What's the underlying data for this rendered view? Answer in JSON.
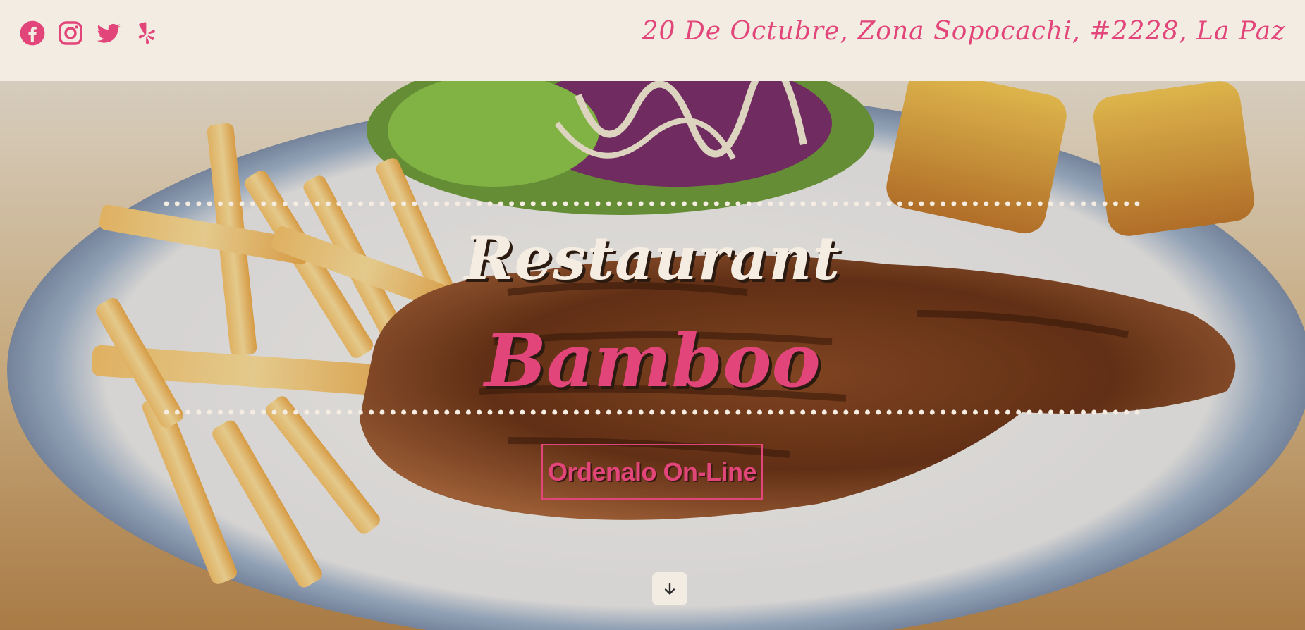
{
  "header": {
    "socials": [
      {
        "icon": "facebook-icon"
      },
      {
        "icon": "instagram-icon"
      },
      {
        "icon": "twitter-icon"
      },
      {
        "icon": "yelp-icon"
      }
    ],
    "address": "20 De Octubre, Zona Sopocachi, #2228, La Paz"
  },
  "hero": {
    "title_line1": "Restaurant",
    "title_line2": "Bamboo",
    "order_button": "Ordenalo On-Line",
    "scroll_icon": "arrow-down-icon"
  },
  "colors": {
    "accent": "#e2457a",
    "background": "#f3ece2",
    "cream_text": "#f5ede2"
  }
}
